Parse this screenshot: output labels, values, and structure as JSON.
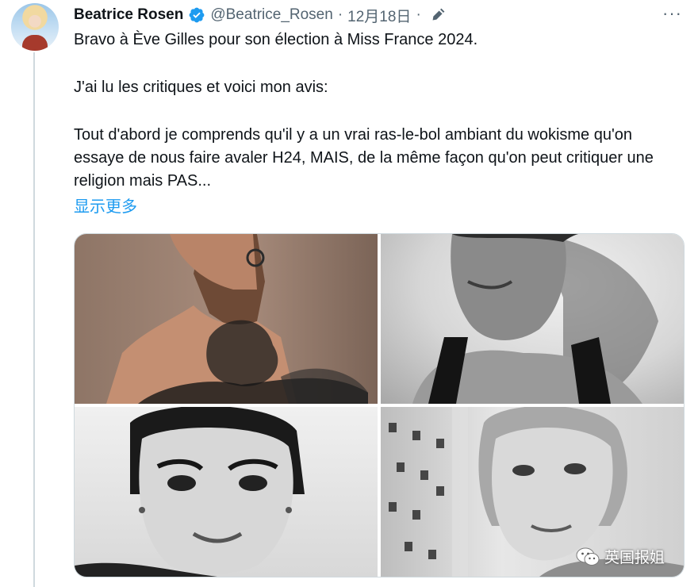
{
  "tweet": {
    "author_name": "Beatrice Rosen",
    "handle": "@Beatrice_Rosen",
    "separator": "·",
    "date": "12月18日",
    "separator2": "·",
    "more": "···",
    "paragraph_1": "Bravo à Ève Gilles pour son élection à Miss France 2024.",
    "paragraph_2": "J'ai lu les critiques et voici mon avis:",
    "paragraph_3": "Tout d'abord je comprends qu'il y a un vrai ras-le-bol ambiant du wokisme qu'on essaye de nous faire avaler H24, MAIS, de la même façon qu'on peut critiquer une religion mais PAS...",
    "show_more": "显示更多"
  },
  "icons": {
    "verified": "verified-badge-icon",
    "edit": "edit-pencil-icon",
    "more": "more-options-icon",
    "watermark": "wechat-icon"
  },
  "colors": {
    "accent": "#1d9bf0",
    "secondary_text": "#536471",
    "thread_line": "#cfd9de"
  },
  "watermark": {
    "label": "英国报姐"
  }
}
